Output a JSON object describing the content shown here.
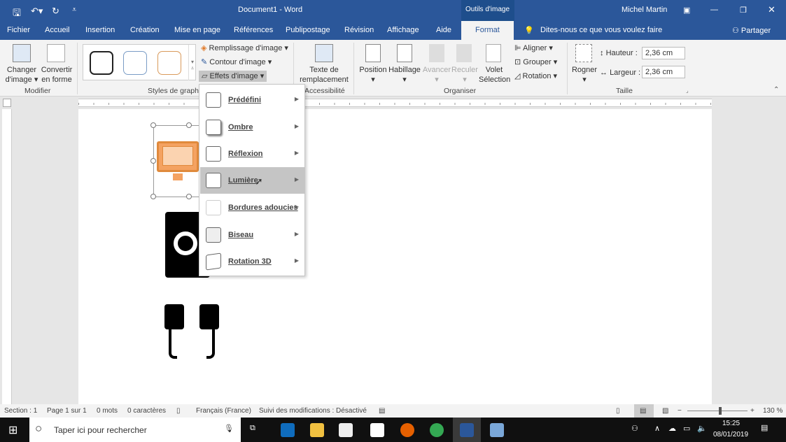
{
  "titlebar": {
    "title": "Document1 - Word",
    "context_tab": "Outils d'image",
    "user": "Michel Martin"
  },
  "tabs": [
    "Fichier",
    "Accueil",
    "Insertion",
    "Création",
    "Mise en page",
    "Références",
    "Publipostage",
    "Révision",
    "Affichage",
    "Aide",
    "Format"
  ],
  "tell_me": "Dites-nous ce que vous voulez faire",
  "share": "Partager",
  "ribbon": {
    "changer": [
      "Changer",
      "d'image ▾"
    ],
    "convertir": [
      "Convertir",
      "en forme"
    ],
    "modifier": "Modifier",
    "styles_group": "Styles de graphi",
    "remplissage": "Remplissage d'image ▾",
    "contour": "Contour d'image ▾",
    "effets": "Effets d'image ▾",
    "texte": [
      "Texte de",
      "remplacement"
    ],
    "accessibilite": "Accessibilité",
    "position": "Position",
    "habillage": "Habillage",
    "avancer": "Avancer",
    "reculer": "Reculer",
    "volet": [
      "Volet",
      "Sélection"
    ],
    "aligner": "Aligner ▾",
    "grouper": "Grouper ▾",
    "rotation": "Rotation ▾",
    "organiser": "Organiser",
    "rogner": "Rogner",
    "hauteur_label": "Hauteur :",
    "hauteur": "2,36 cm",
    "largeur_label": "Largeur :",
    "largeur": "2,36 cm",
    "taille": "Taille"
  },
  "menu": [
    {
      "label": "Prédéfini"
    },
    {
      "label": "Ombre"
    },
    {
      "label": "Réflexion"
    },
    {
      "label": "Lumière",
      "hover": true
    },
    {
      "label": "Bordures adoucies"
    },
    {
      "label": "Biseau"
    },
    {
      "label": "Rotation 3D"
    }
  ],
  "status": {
    "section": "Section : 1",
    "page": "Page 1 sur 1",
    "words": "0 mots",
    "chars": "0 caractères",
    "lang": "Français (France)",
    "track": "Suivi des modifications : Désactivé",
    "zoom": "130 %"
  },
  "taskbar": {
    "search": "Taper ici pour rechercher",
    "time": "15:25",
    "date": "08/01/2019"
  },
  "colors": {
    "accent": "#2b579a",
    "orange": "#f4a261"
  }
}
